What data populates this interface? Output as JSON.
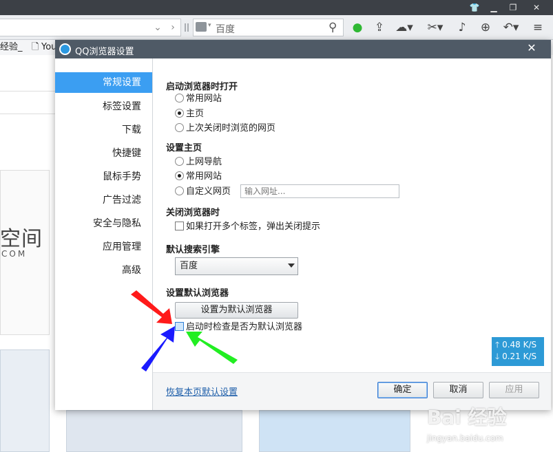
{
  "search": {
    "placeholder": "百度"
  },
  "bookmarks": {
    "item1": "经验_",
    "item2": "You"
  },
  "background_page": {
    "logo_text": "空间",
    "logo_sub": "COM"
  },
  "dialog": {
    "title": "QQ浏览器设置",
    "menu": [
      "常规设置",
      "标签设置",
      "下载",
      "快捷键",
      "鼠标手势",
      "广告过滤",
      "安全与隐私",
      "应用管理",
      "高级"
    ],
    "startup": {
      "heading": "启动浏览器时打开",
      "options": [
        "常用网站",
        "主页",
        "上次关闭时浏览的网页"
      ],
      "selected_index": 1
    },
    "homepage": {
      "heading": "设置主页",
      "options": [
        "上网导航",
        "常用网站",
        "自定义网页"
      ],
      "selected_index": 1,
      "url_placeholder": "输入网址..."
    },
    "close_browser": {
      "heading": "关闭浏览器时",
      "checkbox_label": "如果打开多个标签，弹出关闭提示",
      "checked": false
    },
    "search_engine": {
      "heading": "默认搜索引擎",
      "selected": "百度"
    },
    "default_browser": {
      "heading": "设置默认浏览器",
      "button": "设置为默认浏览器",
      "checkbox_label": "启动时检查是否为默认浏览器",
      "checked": false
    },
    "footer": {
      "restore": "恢复本页默认设置",
      "ok": "确定",
      "cancel": "取消",
      "apply": "应用"
    }
  },
  "speed": {
    "up": "0.48 K/S",
    "down": "0.21 K/S"
  },
  "colors": {
    "accent": "#3b9ef2",
    "titlebar": "#4f5a66",
    "red_arrow": "#ff1a1a",
    "blue_arrow": "#1a1aff",
    "green_arrow": "#22ee22"
  },
  "watermark": {
    "text": "Bai 经验",
    "sub": "jingyan.baidu.com"
  }
}
